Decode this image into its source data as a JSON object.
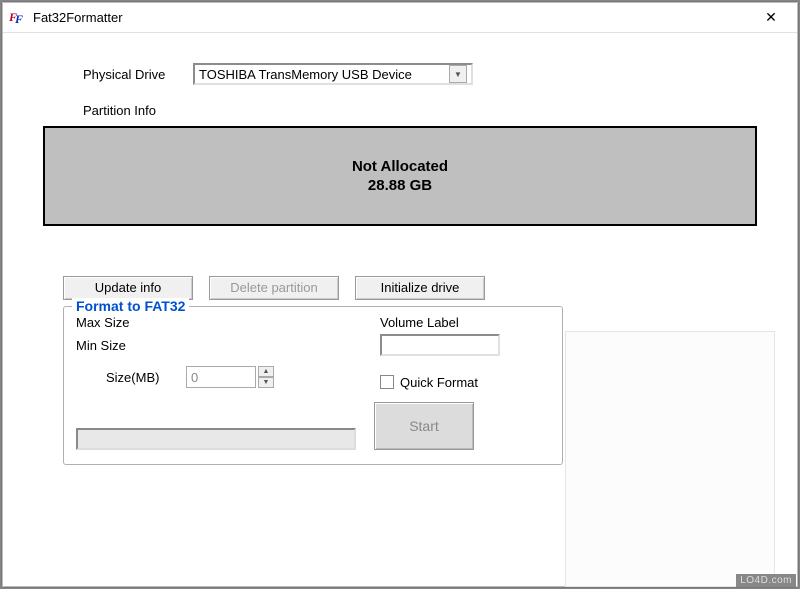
{
  "window": {
    "title": "Fat32Formatter"
  },
  "drive": {
    "label": "Physical Drive",
    "selected": "TOSHIBA TransMemory USB Device"
  },
  "partinfo": {
    "label": "Partition Info",
    "status": "Not Allocated",
    "size": "28.88 GB"
  },
  "buttons": {
    "update": "Update info",
    "delete": "Delete partition",
    "init": "Initialize drive"
  },
  "groupbox": {
    "title": "Format to FAT32",
    "maxsize_label": "Max Size",
    "minsize_label": "Min Size",
    "size_label": "Size(MB)",
    "size_value": "0",
    "volume_label": "Volume Label",
    "volume_value": "",
    "quickformat_label": "Quick Format",
    "start_label": "Start"
  },
  "watermark": "LO4D.com"
}
